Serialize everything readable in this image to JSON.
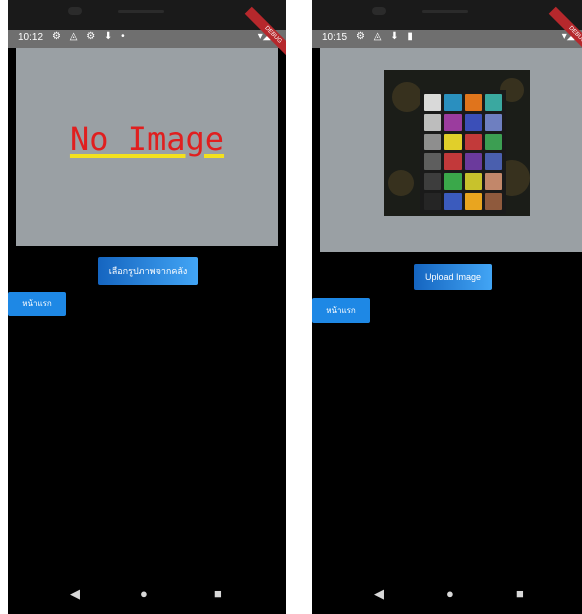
{
  "left_screen": {
    "status": {
      "time": "10:12",
      "left_icons": "⚙ ◬ ⚙ ⬇ •",
      "right_icons": "▾◢▮"
    },
    "ribbon": "DEBUG",
    "placeholder_text": "No Image",
    "primary_button": "เลือกรูปภาพจากคลัง",
    "home_button": "หน้าแรก",
    "nav": {
      "back": "◀",
      "home": "●",
      "recent": "■"
    }
  },
  "right_screen": {
    "status": {
      "time": "10:15",
      "left_icons": "⚙ ◬ ⬇ ▮",
      "right_icons": "▾◢▮"
    },
    "ribbon": "DEBUG",
    "primary_button": "Upload Image",
    "home_button": "หน้าแรก",
    "nav": {
      "back": "◀",
      "home": "●",
      "recent": "■"
    },
    "checker_colors": [
      "#d9d9d9",
      "#2a8fbf",
      "#e0741c",
      "#3aa8a0",
      "#bdbdbd",
      "#9b3c9e",
      "#3b4fb8",
      "#6e7fc0",
      "#8e8e8e",
      "#e1cf2a",
      "#c23a3a",
      "#3c9e52",
      "#5e5e5e",
      "#c2393a",
      "#6b3a9c",
      "#4a5fae",
      "#3d3d3d",
      "#3aa84a",
      "#c8c22c",
      "#c2876a",
      "#252525",
      "#3b5bbd",
      "#e9a51f",
      "#8f5a3d"
    ]
  }
}
